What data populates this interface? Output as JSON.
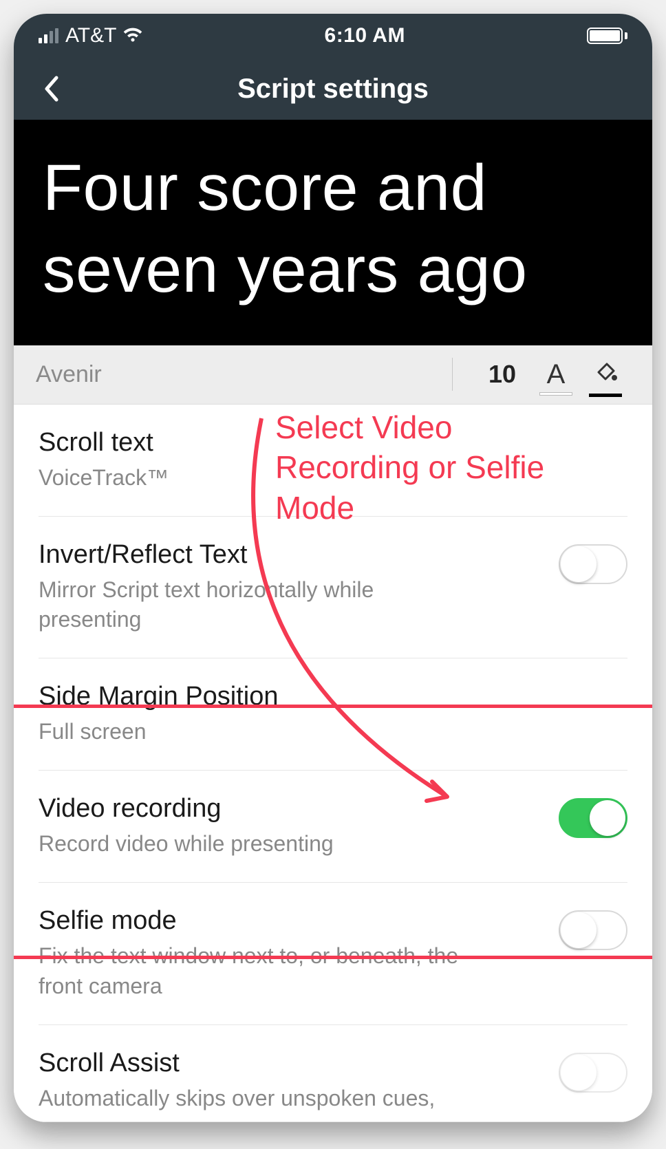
{
  "status": {
    "carrier": "AT&T",
    "time": "6:10 AM"
  },
  "nav": {
    "title": "Script settings"
  },
  "preview": {
    "text": "Four score and seven years ago"
  },
  "format_bar": {
    "font": "Avenir",
    "size": "10"
  },
  "settings": {
    "scroll_text": {
      "title": "Scroll text",
      "sub": "VoiceTrack™"
    },
    "invert": {
      "title": "Invert/Reflect Text",
      "sub": "Mirror Script text horizontally while presenting",
      "on": false
    },
    "margin": {
      "title": "Side Margin Position",
      "sub": "Full screen"
    },
    "video": {
      "title": "Video recording",
      "sub": "Record video while presenting",
      "on": true
    },
    "selfie": {
      "title": "Selfie mode",
      "sub": "Fix the text window next to, or beneath, the front camera",
      "on": false
    },
    "assist": {
      "title": "Scroll Assist",
      "sub": "Automatically skips over unspoken cues,",
      "on": false
    }
  },
  "annotation": {
    "text": "Select Video Recording or Selfie Mode"
  }
}
